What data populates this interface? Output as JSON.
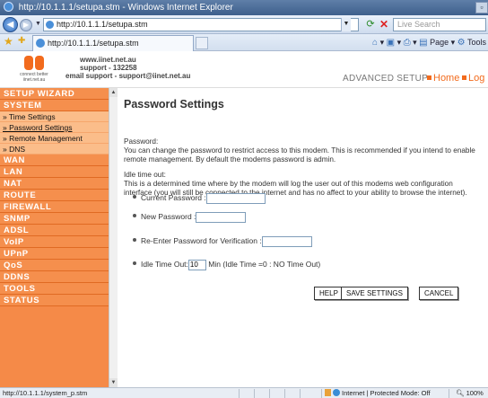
{
  "window": {
    "title": "http://10.1.1.1/setupa.stm - Windows Internet Explorer",
    "restore_glyph": "▫"
  },
  "browser": {
    "address": "http://10.1.1.1/setupa.stm",
    "search_placeholder": "Live Search",
    "tab_title": "http://10.1.1.1/setupa.stm",
    "toolbar_page": "Page",
    "toolbar_tools": "Tools"
  },
  "header": {
    "logo_tagline": "connect better",
    "logo_sub": "iinet.net.au",
    "site": "www.iinet.net.au",
    "support_phone": "support - 132258",
    "support_email": "email support - support@iinet.net.au",
    "advanced_setup": "ADVANCED SETUP",
    "home_link": "Home",
    "logout_link": "Log"
  },
  "sidebar": {
    "sections_top": [
      "SETUP WIZARD",
      "SYSTEM"
    ],
    "system_items": [
      "» Time Settings",
      "» Password Settings",
      "» Remote Management",
      "» DNS"
    ],
    "sections_bottom": [
      "WAN",
      "LAN",
      "NAT",
      "ROUTE",
      "FIREWALL",
      "SNMP",
      "ADSL",
      "VoIP",
      "UPnP",
      "QoS",
      "DDNS",
      "TOOLS",
      "STATUS"
    ],
    "active_item": "» Password Settings"
  },
  "main": {
    "title": "Password Settings",
    "password_heading": "Password:",
    "password_desc": "You can change the password to restrict access to this modem. This is recommended if you intend to enable remote management. By default the modems password is admin.",
    "idle_heading": "Idle time out:",
    "idle_desc": "This is a determined time where by the modem will log the user out of this modems web configuration interface (you will still be connected to the internet and has no affect to your ability to browse the internet).",
    "current_password_label": "Current Password :",
    "new_password_label": "New Password :",
    "reenter_label": "Re-Enter Password for Verification :",
    "idle_label": "Idle Time Out:",
    "idle_value": "10",
    "idle_suffix": "Min (Idle Time =0 : NO Time Out)",
    "help_label": "HELP",
    "save_label": "SAVE SETTINGS",
    "cancel_label": "CANCEL"
  },
  "status": {
    "url": "http://10.1.1.1/system_p.stm",
    "zone": "Internet | Protected Mode: Off",
    "zoom": "100%"
  },
  "colors": {
    "accent": "#f26b1d",
    "sidebar": "#f58a48",
    "sidebar_sub": "#fbbd8a"
  }
}
